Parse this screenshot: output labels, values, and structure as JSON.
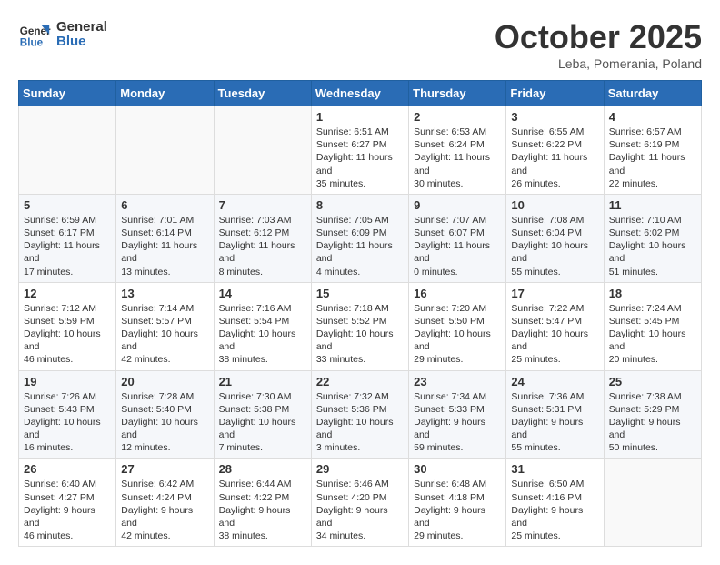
{
  "header": {
    "logo_line1": "General",
    "logo_line2": "Blue",
    "title": "October 2025",
    "location": "Leba, Pomerania, Poland"
  },
  "days_of_week": [
    "Sunday",
    "Monday",
    "Tuesday",
    "Wednesday",
    "Thursday",
    "Friday",
    "Saturday"
  ],
  "weeks": [
    [
      {
        "day": "",
        "info": ""
      },
      {
        "day": "",
        "info": ""
      },
      {
        "day": "",
        "info": ""
      },
      {
        "day": "1",
        "info": "Sunrise: 6:51 AM\nSunset: 6:27 PM\nDaylight: 11 hours and 35 minutes."
      },
      {
        "day": "2",
        "info": "Sunrise: 6:53 AM\nSunset: 6:24 PM\nDaylight: 11 hours and 30 minutes."
      },
      {
        "day": "3",
        "info": "Sunrise: 6:55 AM\nSunset: 6:22 PM\nDaylight: 11 hours and 26 minutes."
      },
      {
        "day": "4",
        "info": "Sunrise: 6:57 AM\nSunset: 6:19 PM\nDaylight: 11 hours and 22 minutes."
      }
    ],
    [
      {
        "day": "5",
        "info": "Sunrise: 6:59 AM\nSunset: 6:17 PM\nDaylight: 11 hours and 17 minutes."
      },
      {
        "day": "6",
        "info": "Sunrise: 7:01 AM\nSunset: 6:14 PM\nDaylight: 11 hours and 13 minutes."
      },
      {
        "day": "7",
        "info": "Sunrise: 7:03 AM\nSunset: 6:12 PM\nDaylight: 11 hours and 8 minutes."
      },
      {
        "day": "8",
        "info": "Sunrise: 7:05 AM\nSunset: 6:09 PM\nDaylight: 11 hours and 4 minutes."
      },
      {
        "day": "9",
        "info": "Sunrise: 7:07 AM\nSunset: 6:07 PM\nDaylight: 11 hours and 0 minutes."
      },
      {
        "day": "10",
        "info": "Sunrise: 7:08 AM\nSunset: 6:04 PM\nDaylight: 10 hours and 55 minutes."
      },
      {
        "day": "11",
        "info": "Sunrise: 7:10 AM\nSunset: 6:02 PM\nDaylight: 10 hours and 51 minutes."
      }
    ],
    [
      {
        "day": "12",
        "info": "Sunrise: 7:12 AM\nSunset: 5:59 PM\nDaylight: 10 hours and 46 minutes."
      },
      {
        "day": "13",
        "info": "Sunrise: 7:14 AM\nSunset: 5:57 PM\nDaylight: 10 hours and 42 minutes."
      },
      {
        "day": "14",
        "info": "Sunrise: 7:16 AM\nSunset: 5:54 PM\nDaylight: 10 hours and 38 minutes."
      },
      {
        "day": "15",
        "info": "Sunrise: 7:18 AM\nSunset: 5:52 PM\nDaylight: 10 hours and 33 minutes."
      },
      {
        "day": "16",
        "info": "Sunrise: 7:20 AM\nSunset: 5:50 PM\nDaylight: 10 hours and 29 minutes."
      },
      {
        "day": "17",
        "info": "Sunrise: 7:22 AM\nSunset: 5:47 PM\nDaylight: 10 hours and 25 minutes."
      },
      {
        "day": "18",
        "info": "Sunrise: 7:24 AM\nSunset: 5:45 PM\nDaylight: 10 hours and 20 minutes."
      }
    ],
    [
      {
        "day": "19",
        "info": "Sunrise: 7:26 AM\nSunset: 5:43 PM\nDaylight: 10 hours and 16 minutes."
      },
      {
        "day": "20",
        "info": "Sunrise: 7:28 AM\nSunset: 5:40 PM\nDaylight: 10 hours and 12 minutes."
      },
      {
        "day": "21",
        "info": "Sunrise: 7:30 AM\nSunset: 5:38 PM\nDaylight: 10 hours and 7 minutes."
      },
      {
        "day": "22",
        "info": "Sunrise: 7:32 AM\nSunset: 5:36 PM\nDaylight: 10 hours and 3 minutes."
      },
      {
        "day": "23",
        "info": "Sunrise: 7:34 AM\nSunset: 5:33 PM\nDaylight: 9 hours and 59 minutes."
      },
      {
        "day": "24",
        "info": "Sunrise: 7:36 AM\nSunset: 5:31 PM\nDaylight: 9 hours and 55 minutes."
      },
      {
        "day": "25",
        "info": "Sunrise: 7:38 AM\nSunset: 5:29 PM\nDaylight: 9 hours and 50 minutes."
      }
    ],
    [
      {
        "day": "26",
        "info": "Sunrise: 6:40 AM\nSunset: 4:27 PM\nDaylight: 9 hours and 46 minutes."
      },
      {
        "day": "27",
        "info": "Sunrise: 6:42 AM\nSunset: 4:24 PM\nDaylight: 9 hours and 42 minutes."
      },
      {
        "day": "28",
        "info": "Sunrise: 6:44 AM\nSunset: 4:22 PM\nDaylight: 9 hours and 38 minutes."
      },
      {
        "day": "29",
        "info": "Sunrise: 6:46 AM\nSunset: 4:20 PM\nDaylight: 9 hours and 34 minutes."
      },
      {
        "day": "30",
        "info": "Sunrise: 6:48 AM\nSunset: 4:18 PM\nDaylight: 9 hours and 29 minutes."
      },
      {
        "day": "31",
        "info": "Sunrise: 6:50 AM\nSunset: 4:16 PM\nDaylight: 9 hours and 25 minutes."
      },
      {
        "day": "",
        "info": ""
      }
    ]
  ]
}
